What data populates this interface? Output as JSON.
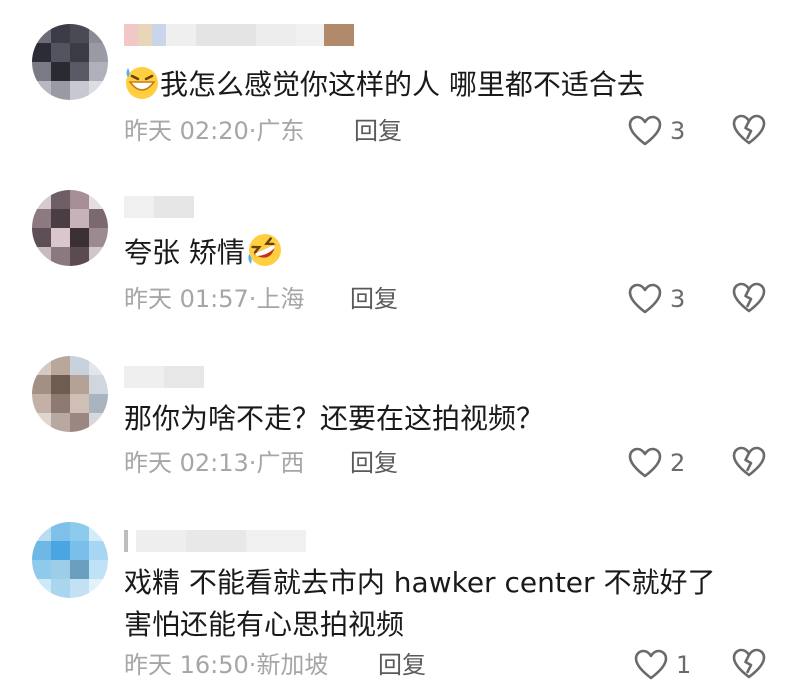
{
  "comments": [
    {
      "text": "我怎么感觉你这样的人 哪里都不适合去",
      "time": "昨天 02:20",
      "location": "广东",
      "reply_label": "回复",
      "likes": "3",
      "emoji": "grinning-sweat-emoji"
    },
    {
      "text": "夸张 矫情",
      "time": "昨天 01:57",
      "location": "上海",
      "reply_label": "回复",
      "likes": "3",
      "emoji": "rolling-laughing-emoji"
    },
    {
      "text": "那你为啥不走？还要在这拍视频？",
      "time": "昨天 02:13",
      "location": "广西",
      "reply_label": "回复",
      "likes": "2"
    },
    {
      "text_line1": "戏精 不能看就去市内 hawker center 不就好了",
      "text_line2": "害怕还能有心思拍视频",
      "time": "昨天 16:50",
      "location": "新加坡",
      "reply_label": "回复",
      "likes": "1"
    }
  ],
  "meta_separator": "·",
  "colors": {
    "meta_gray": "#a6a6a6",
    "reply_gray": "#5a5a5a",
    "icon_gray": "#6a6a6a"
  }
}
